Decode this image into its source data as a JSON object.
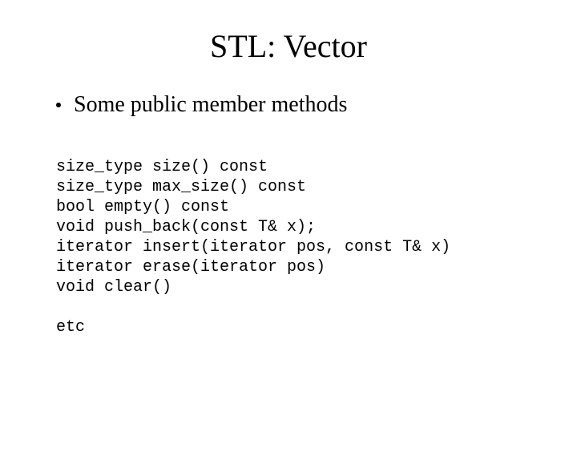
{
  "title": "STL: Vector",
  "bullet": "Some public member methods",
  "code_lines": [
    "size_type size() const",
    "size_type max_size() const",
    "bool empty() const",
    "void push_back(const T& x);",
    "iterator insert(iterator pos, const T& x)",
    "iterator erase(iterator pos)",
    "void clear()",
    "",
    "etc"
  ]
}
